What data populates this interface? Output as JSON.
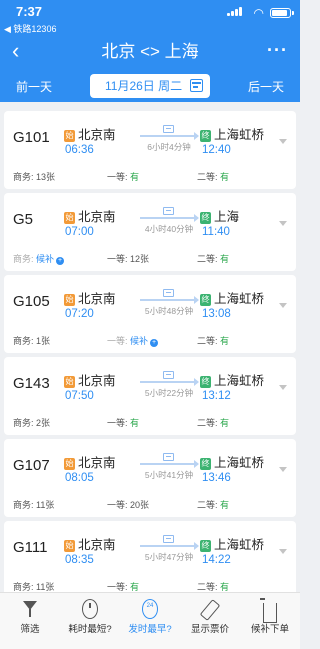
{
  "status": {
    "time": "7:37",
    "back_app": "◀ 铁路12306"
  },
  "nav": {
    "title": "北京 <> 上海"
  },
  "daybar": {
    "prev": "前一天",
    "date": "11月26日 周二",
    "next": "后一天"
  },
  "trains": [
    {
      "no": "G101",
      "from_badge": "始",
      "from": "北京南",
      "dep": "06:36",
      "duration": "6小时4分钟",
      "to_badge": "终",
      "to": "上海虹桥",
      "arr": "12:40",
      "seats": [
        {
          "label": "商务:",
          "value": "13张",
          "style": "normal"
        },
        {
          "label": "一等:",
          "value": "有",
          "style": "avail"
        },
        {
          "label": "二等:",
          "value": "有",
          "style": "avail"
        }
      ]
    },
    {
      "no": "G5",
      "from_badge": "始",
      "from": "北京南",
      "dep": "07:00",
      "duration": "4小时40分钟",
      "to_badge": "终",
      "to": "上海",
      "arr": "11:40",
      "seats": [
        {
          "label": "商务:",
          "value": "候补",
          "style": "wait"
        },
        {
          "label": "一等:",
          "value": "12张",
          "style": "normal"
        },
        {
          "label": "二等:",
          "value": "有",
          "style": "avail"
        }
      ]
    },
    {
      "no": "G105",
      "from_badge": "始",
      "from": "北京南",
      "dep": "07:20",
      "duration": "5小时48分钟",
      "to_badge": "终",
      "to": "上海虹桥",
      "arr": "13:08",
      "seats": [
        {
          "label": "商务:",
          "value": "1张",
          "style": "normal"
        },
        {
          "label": "一等:",
          "value": "候补",
          "style": "wait"
        },
        {
          "label": "二等:",
          "value": "有",
          "style": "avail"
        }
      ]
    },
    {
      "no": "G143",
      "from_badge": "始",
      "from": "北京南",
      "dep": "07:50",
      "duration": "5小时22分钟",
      "to_badge": "终",
      "to": "上海虹桥",
      "arr": "13:12",
      "seats": [
        {
          "label": "商务:",
          "value": "2张",
          "style": "normal"
        },
        {
          "label": "一等:",
          "value": "有",
          "style": "avail"
        },
        {
          "label": "二等:",
          "value": "有",
          "style": "avail"
        }
      ]
    },
    {
      "no": "G107",
      "from_badge": "始",
      "from": "北京南",
      "dep": "08:05",
      "duration": "5小时41分钟",
      "to_badge": "终",
      "to": "上海虹桥",
      "arr": "13:46",
      "seats": [
        {
          "label": "商务:",
          "value": "11张",
          "style": "normal"
        },
        {
          "label": "一等:",
          "value": "20张",
          "style": "normal"
        },
        {
          "label": "二等:",
          "value": "有",
          "style": "avail"
        }
      ]
    },
    {
      "no": "G111",
      "from_badge": "始",
      "from": "北京南",
      "dep": "08:35",
      "duration": "5小时47分钟",
      "to_badge": "终",
      "to": "上海虹桥",
      "arr": "14:22",
      "seats": [
        {
          "label": "商务:",
          "value": "11张",
          "style": "normal"
        },
        {
          "label": "一等:",
          "value": "有",
          "style": "avail"
        },
        {
          "label": "二等:",
          "value": "有",
          "style": "avail"
        }
      ]
    }
  ],
  "tabbar": {
    "items": [
      {
        "label": "筛选",
        "icon": "filter-icon"
      },
      {
        "label": "耗时最短?",
        "icon": "clock-icon"
      },
      {
        "label": "发时最早?",
        "icon": "clock-24-icon",
        "active": true,
        "icon_text": "24"
      },
      {
        "label": "显示票价",
        "icon": "price-tag-icon"
      },
      {
        "label": "候补下单",
        "icon": "cart-icon"
      }
    ]
  },
  "colors": {
    "primary": "#2f8ef2",
    "available": "#2ea84f",
    "start_badge": "#f29a38",
    "end_badge": "#3cb371"
  }
}
